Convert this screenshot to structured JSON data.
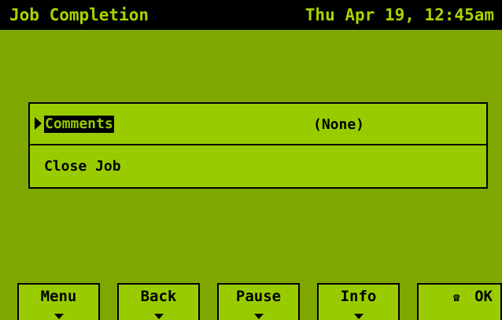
{
  "header": {
    "title": "Job Completion",
    "datetime": "Thu Apr 19, 12:45am"
  },
  "menu": {
    "items": [
      {
        "label": "Comments",
        "value": "(None)",
        "selected": true
      },
      {
        "label": "Close Job",
        "value": ""
      }
    ]
  },
  "softkeys": [
    {
      "label": "Menu"
    },
    {
      "label": "Back"
    },
    {
      "label": "Pause"
    },
    {
      "label": "Info"
    },
    {
      "label": "OK"
    }
  ],
  "colors": {
    "header_bg": "#000000",
    "panel_row": "#99cc00",
    "text": "#000000"
  }
}
